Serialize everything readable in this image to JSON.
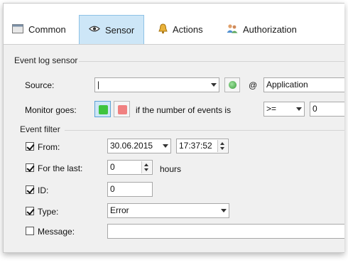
{
  "tabs": [
    {
      "label": "Common",
      "icon": "window-icon"
    },
    {
      "label": "Sensor",
      "icon": "eye-icon",
      "active": true
    },
    {
      "label": "Actions",
      "icon": "bell-icon"
    },
    {
      "label": "Authorization",
      "icon": "users-icon"
    }
  ],
  "event_log_sensor": {
    "title": "Event log sensor",
    "source_label": "Source:",
    "source_value": "|",
    "at_symbol": "@",
    "computer_value": "Application",
    "monitor_label": "Monitor goes:",
    "condition_text": "if the number of events is",
    "operator_value": ">=",
    "count_value": "0",
    "colors": {
      "green": "#3ec43e",
      "red": "#f08080"
    }
  },
  "event_filter": {
    "title": "Event filter",
    "from_label": "From:",
    "from_checked": true,
    "from_date": "30.06.2015",
    "from_time": "17:37:52",
    "last_label": "For the last:",
    "last_checked": true,
    "last_value": "0",
    "last_unit": "hours",
    "id_label": "ID:",
    "id_checked": true,
    "id_value": "0",
    "type_label": "Type:",
    "type_checked": true,
    "type_value": "Error",
    "message_label": "Message:",
    "message_checked": false,
    "message_value": ""
  }
}
